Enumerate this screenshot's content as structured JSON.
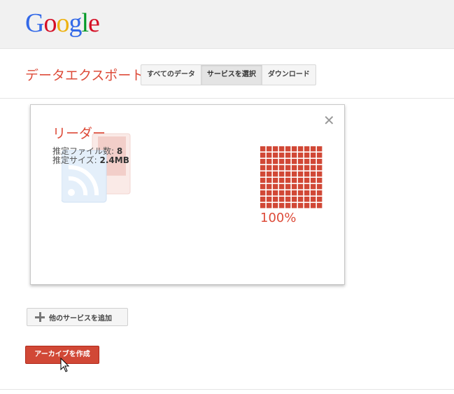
{
  "logo": {
    "letters": [
      "G",
      "o",
      "o",
      "g",
      "l",
      "e"
    ],
    "colors": [
      "#3369e8",
      "#d50f25",
      "#eeb211",
      "#3369e8",
      "#009925",
      "#d50f25"
    ]
  },
  "header": {
    "title": "データエクスポート",
    "tabs": [
      {
        "label": "すべてのデータ",
        "active": false
      },
      {
        "label": "サービスを選択",
        "active": true
      },
      {
        "label": "ダウンロード",
        "active": false
      }
    ]
  },
  "card": {
    "service_name": "リーダー",
    "file_count_label": "推定ファイル数:",
    "file_count_value": "8",
    "size_label": "推定サイズ:",
    "size_value": "2.4MB",
    "progress_percent": "100%",
    "progress_fraction": 1.0,
    "close_icon": "close-icon",
    "service_icon": "reader-icon"
  },
  "actions": {
    "add_services_label": "他のサービスを追加",
    "create_archive_label": "アーカイブを作成"
  },
  "colors": {
    "accent": "#dd4b39",
    "button_red": "#d14836",
    "progress": "#d14836"
  }
}
